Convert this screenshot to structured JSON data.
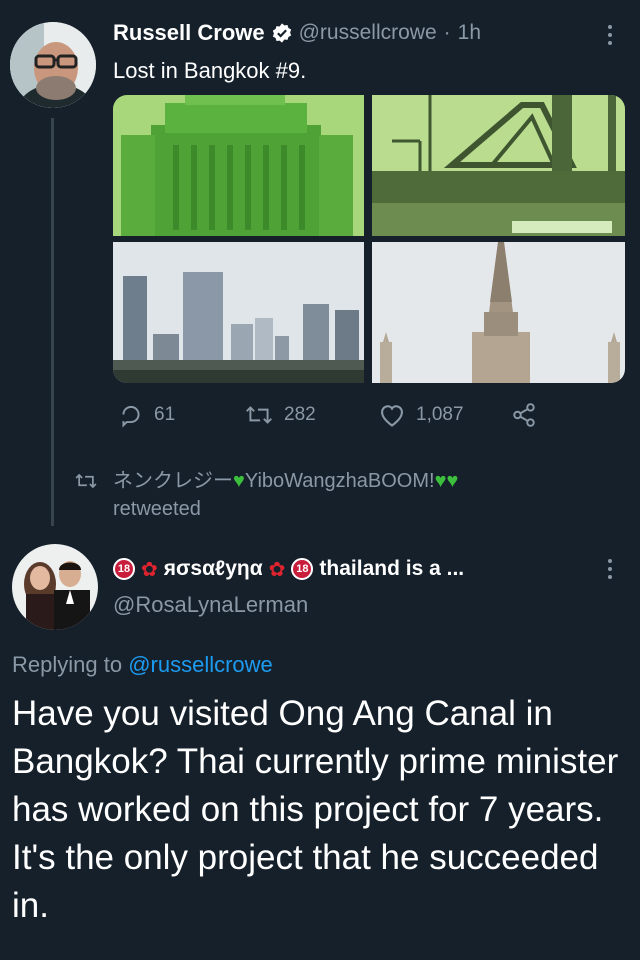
{
  "tweet": {
    "author_name": "Russell Crowe",
    "handle": "@russellcrowe",
    "separator": "·",
    "time": "1h",
    "text": "Lost in Bangkok #9.",
    "images": [
      "tile-1",
      "tile-2",
      "tile-3",
      "tile-4"
    ],
    "actions": {
      "replies": "61",
      "retweets": "282",
      "likes": "1,087"
    },
    "more_icon": "more-vertical-icon",
    "verified_icon": "verified-badge-icon"
  },
  "retweet_notice": {
    "prefix": "ネンクレジー",
    "middle": "YiboWangzhaBOOM!",
    "line2": "retweeted"
  },
  "reply": {
    "name_part1": "яσѕαℓуηα",
    "name_part2": "thailand is a ...",
    "badge_text": "18",
    "handle": "@RosaLynaLerman",
    "replying_prefix": "Replying to",
    "replying_to": "@russellcrowe",
    "text": "Have you visited Ong Ang Canal in Bangkok? Thai currently prime minister has worked on this project for 7 years. It's the only project that he succeeded in."
  },
  "colors": {
    "background": "#15202b",
    "muted": "#8b98a5",
    "accent": "#1d9bf0"
  }
}
